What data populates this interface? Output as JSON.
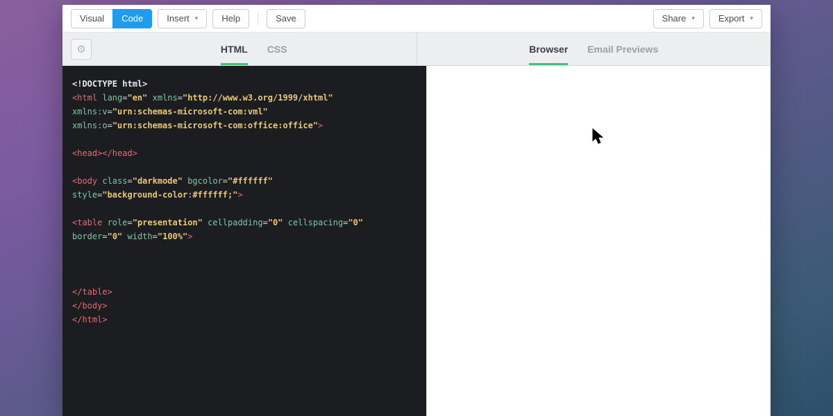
{
  "toolbar": {
    "visual_label": "Visual",
    "code_label": "Code",
    "insert_label": "Insert",
    "help_label": "Help",
    "save_label": "Save",
    "share_label": "Share",
    "export_label": "Export"
  },
  "subheader": {
    "left_tabs": {
      "html": "HTML",
      "css": "CSS"
    },
    "right_tabs": {
      "browser": "Browser",
      "email": "Email Previews"
    }
  },
  "code": {
    "l1": "<!DOCTYPE html>",
    "l2": {
      "tag_open": "<html",
      "attr1": " lang",
      "eq1": "=",
      "val1": "\"en\"",
      "attr2": " xmlns",
      "eq2": "=",
      "val2": "\"http://www.w3.org/1999/xhtml\"",
      "attr3": " xmlns:v",
      "eq3": "=",
      "val3": "\"urn:schemas-microsoft-com:vml\"",
      "attr4": " xmlns:o",
      "eq4": "=",
      "val4": "\"urn:schemas-microsoft-com:office:office\"",
      "tag_close": ">"
    },
    "l3": {
      "open": "<head>",
      "close": "</head>"
    },
    "l4": {
      "tag_open": "<body",
      "attr1": " class",
      "eq1": "=",
      "val1": "\"darkmode\"",
      "attr2": " bgcolor",
      "eq2": "=",
      "val2": "\"#ffffff\"",
      "attr3": " style",
      "eq3": "=",
      "val3_a": "\"background-color",
      "val3_b": ":",
      "val3_c": "#ffffff;\"",
      "tag_close": ">"
    },
    "l5": {
      "tag_open": "<table",
      "attr1": " role",
      "eq1": "=",
      "val1": "\"presentation\"",
      "attr2": " cellpadding",
      "eq2": "=",
      "val2": "\"0\"",
      "attr3": " cellspacing",
      "eq3": "=",
      "val3": "\"0\"",
      "attr4": " border",
      "eq4": "=",
      "val4": "\"0\"",
      "attr5": " width",
      "eq5": "=",
      "val5": "\"100%\"",
      "tag_close": ">"
    },
    "l6": "</table>",
    "l7": "</body>",
    "l8": "</html>"
  }
}
